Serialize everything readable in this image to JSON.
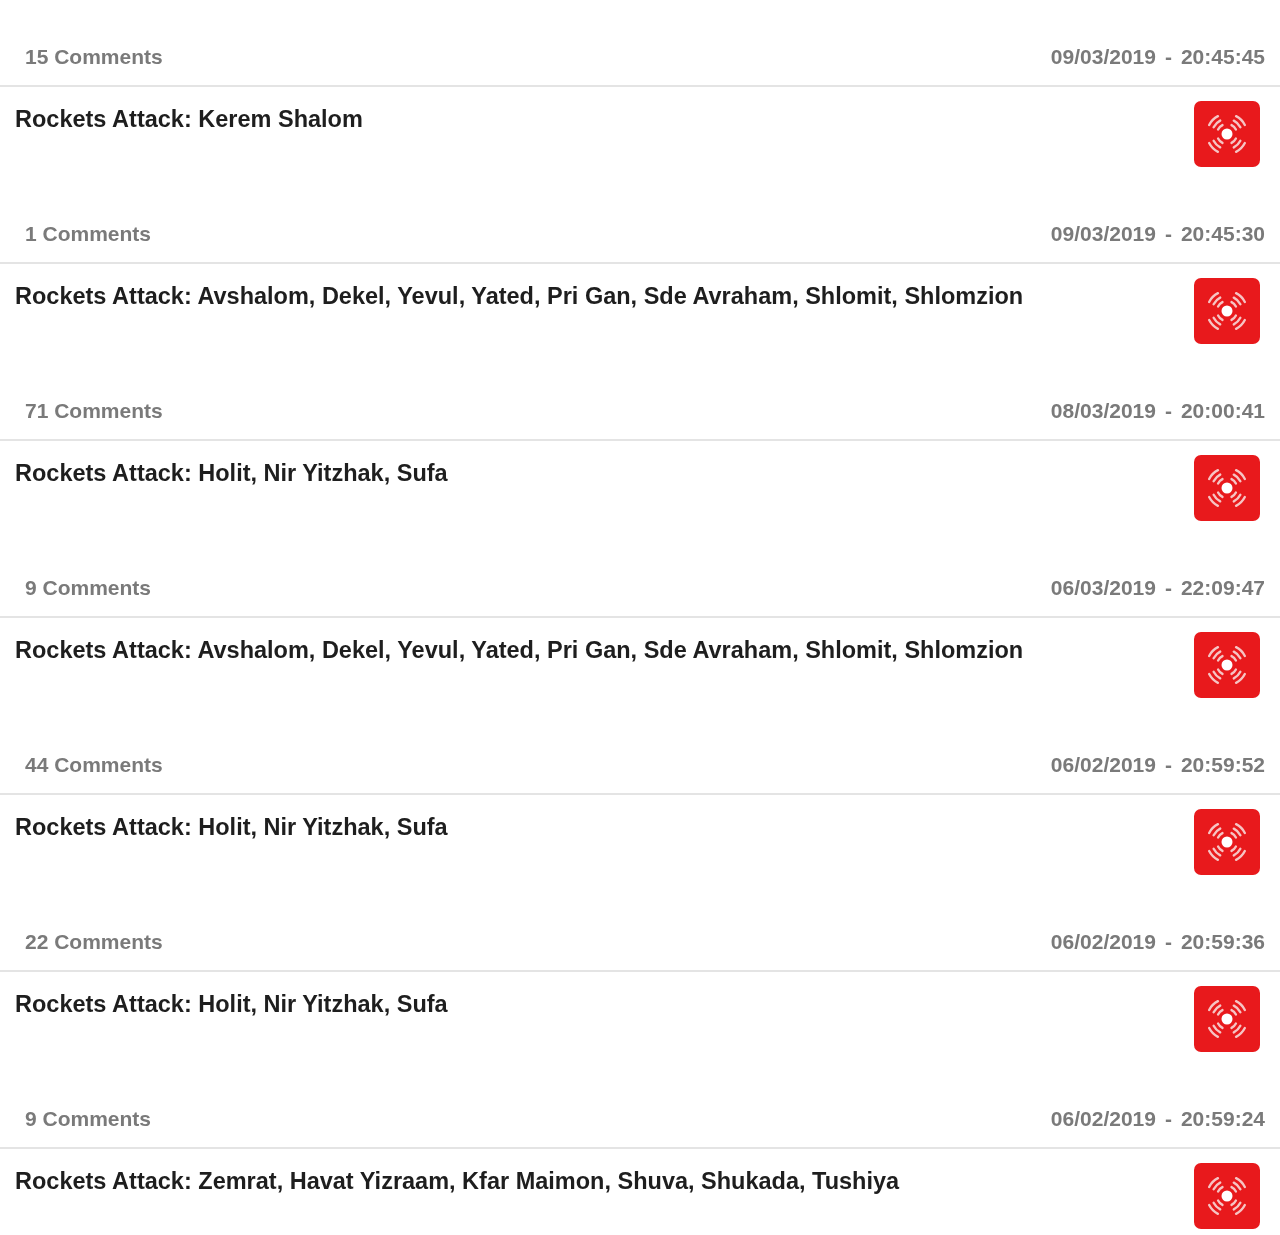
{
  "alerts": [
    {
      "comments": "15 Comments",
      "date": "09/03/2019",
      "separator": "-",
      "time": "20:45:45",
      "title": "Rockets Attack: Kerem Shalom"
    },
    {
      "comments": "1 Comments",
      "date": "09/03/2019",
      "separator": "-",
      "time": "20:45:30",
      "title": "Rockets Attack: Avshalom, Dekel, Yevul, Yated, Pri Gan, Sde Avraham, Shlomit, Shlomzion"
    },
    {
      "comments": "71 Comments",
      "date": "08/03/2019",
      "separator": "-",
      "time": "20:00:41",
      "title": "Rockets Attack: Holit, Nir Yitzhak, Sufa"
    },
    {
      "comments": "9 Comments",
      "date": "06/03/2019",
      "separator": "-",
      "time": "22:09:47",
      "title": "Rockets Attack: Avshalom, Dekel, Yevul, Yated, Pri Gan, Sde Avraham, Shlomit, Shlomzion"
    },
    {
      "comments": "44 Comments",
      "date": "06/02/2019",
      "separator": "-",
      "time": "20:59:52",
      "title": "Rockets Attack: Holit, Nir Yitzhak, Sufa"
    },
    {
      "comments": "22 Comments",
      "date": "06/02/2019",
      "separator": "-",
      "time": "20:59:36",
      "title": "Rockets Attack: Holit, Nir Yitzhak, Sufa"
    },
    {
      "comments": "9 Comments",
      "date": "06/02/2019",
      "separator": "-",
      "time": "20:59:24",
      "title": "Rockets Attack: Zemrat, Havat Yizraam, Kfar Maimon, Shuva, Shukada, Tushiya"
    }
  ]
}
